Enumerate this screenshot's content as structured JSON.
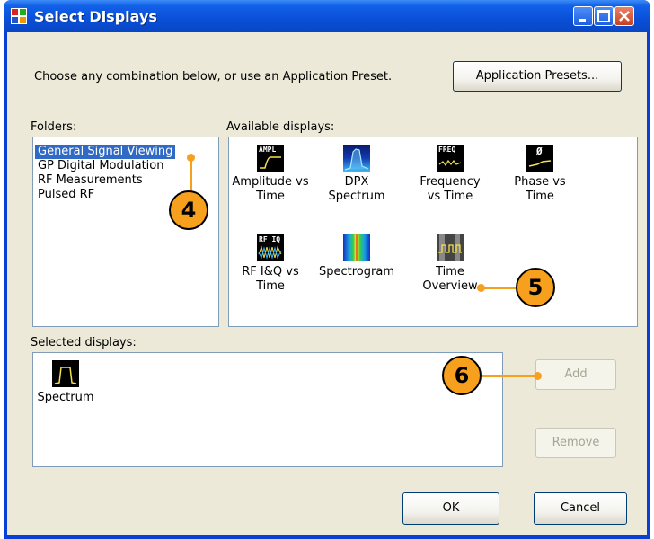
{
  "window": {
    "title": "Select Displays"
  },
  "intro": {
    "text": "Choose any combination below, or use an Application Preset.",
    "presets_button": "Application Presets..."
  },
  "folders": {
    "label": "Folders:",
    "items": [
      "General Signal Viewing",
      "GP Digital Modulation",
      "RF Measurements",
      "Pulsed RF"
    ],
    "selected_index": 0
  },
  "available": {
    "label": "Available displays:",
    "items": [
      {
        "line1": "Amplitude vs",
        "line2": "Time",
        "icon": "amplitude-icon",
        "icon_text": "AMPL"
      },
      {
        "line1": "DPX",
        "line2": "Spectrum",
        "icon": "dpx-spectrum-icon",
        "icon_text": ""
      },
      {
        "line1": "Frequency",
        "line2": "vs Time",
        "icon": "frequency-icon",
        "icon_text": "FREQ"
      },
      {
        "line1": "Phase vs",
        "line2": "Time",
        "icon": "phase-icon",
        "icon_text": "Ø"
      },
      {
        "line1": "RF I&Q vs",
        "line2": "Time",
        "icon": "rf-iq-icon",
        "icon_text": "RF IQ"
      },
      {
        "line1": "Spectrogram",
        "line2": "",
        "icon": "spectrogram-icon",
        "icon_text": ""
      },
      {
        "line1": "Time",
        "line2": "Overview",
        "icon": "time-overview-icon",
        "icon_text": ""
      }
    ]
  },
  "selected": {
    "label": "Selected displays:",
    "items": [
      {
        "label": "Spectrum",
        "icon": "spectrum-icon"
      }
    ]
  },
  "buttons": {
    "add": "Add",
    "remove": "Remove",
    "ok": "OK",
    "cancel": "Cancel"
  },
  "callouts": {
    "c4": "4",
    "c5": "5",
    "c6": "6"
  },
  "colors": {
    "accent": "#f7a01e",
    "title_bar": "#0a4fd8",
    "selection": "#316ac5",
    "dialog_bg": "#ece9d8"
  }
}
